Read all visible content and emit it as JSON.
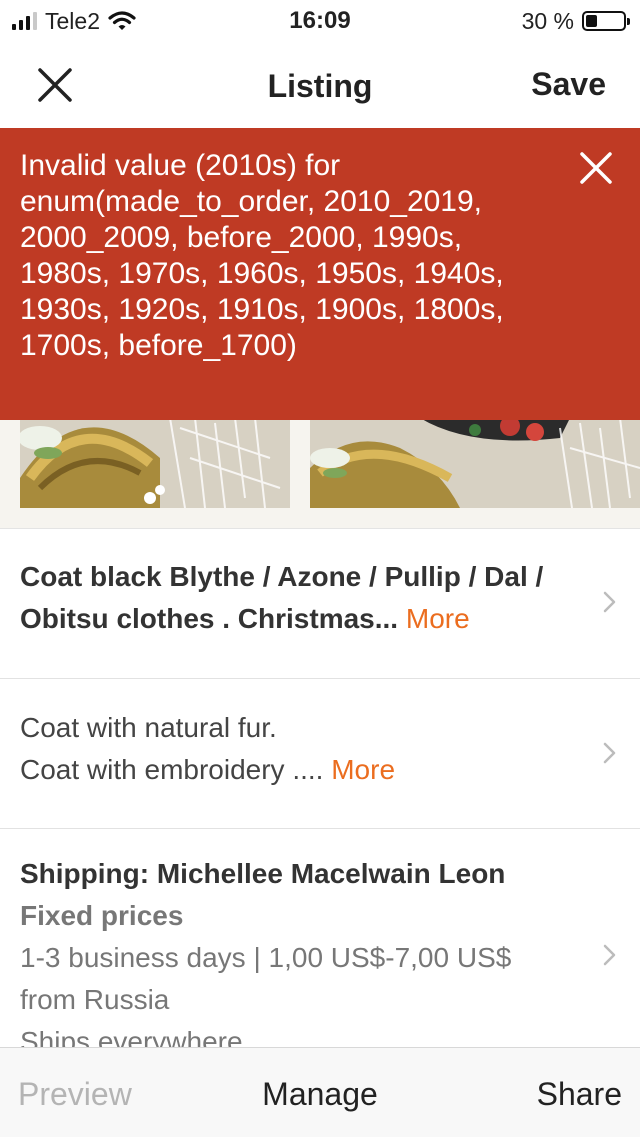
{
  "status_bar": {
    "carrier": "Tele2",
    "time": "16:09",
    "battery_text": "30 %",
    "battery_level": 0.3,
    "icons": [
      "signal-bars-icon",
      "wifi-icon",
      "battery-icon"
    ]
  },
  "navbar": {
    "close_icon": "close-icon",
    "title": "Listing",
    "save_label": "Save"
  },
  "error": {
    "message": "Invalid value (2010s) for enum(made_to_order, 2010_2019, 2000_2009, before_2000, 1990s, 1980s, 1970s, 1960s, 1950s, 1940s, 1930s, 1920s, 1910s, 1900s, 1800s, 1700s, before_1700)",
    "dismiss_icon": "close-icon",
    "background_color": "#bf3a24"
  },
  "listing": {
    "title_row": {
      "text": "Coat black Blythe / Azone / Pullip / Dal  / Obitsu clothes . Christmas...",
      "more_label": "More"
    },
    "description_row": {
      "line1": "Coat with natural fur.",
      "line2": "Coat with embroidery ....",
      "more_label": "More"
    },
    "shipping_row": {
      "title": "Shipping: Michellee Macelwain Leon",
      "pricing": "Fixed prices",
      "details": "1-3 business days | 1,00 US$-7,00 US$",
      "origin": "from Russia",
      "coverage": "Ships everywhere"
    }
  },
  "toolbar": {
    "preview_label": "Preview",
    "manage_label": "Manage",
    "share_label": "Share"
  },
  "colors": {
    "accent": "#eb6d1f",
    "error": "#bf3a24",
    "disabled": "#b4b4b4"
  }
}
